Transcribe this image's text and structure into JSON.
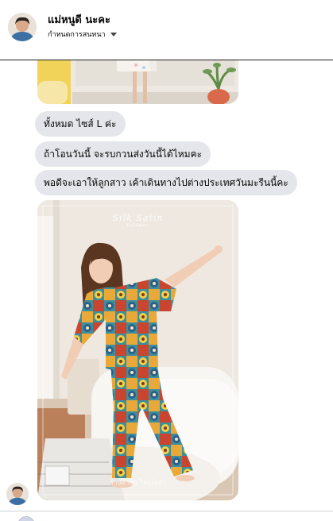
{
  "header": {
    "contact_name": "แม่หนูดี นะคะ",
    "subtitle": "กำหนดการสนทนา"
  },
  "messages": [
    {
      "text": "ทั้งหมด ไซส์ L ค่ะ"
    },
    {
      "text": "ถ้าโอนวันนี้ จะรบกวนส่งวันนี้ได้ไหมคะ"
    },
    {
      "text": "พอดีจะเอาให้ลูกสาว เค้าเดินทางไปต่างประเทศวันมะรืนนี้คะ"
    }
  ],
  "product_image": {
    "brand": "Silk Satin",
    "brand_sub": "Pajamas",
    "watermark": "ร้านผ้าซิ้น ไหมไอยา"
  },
  "colors": {
    "incoming_bubble": "#e4e6eb",
    "divider": "#1c1e21"
  }
}
